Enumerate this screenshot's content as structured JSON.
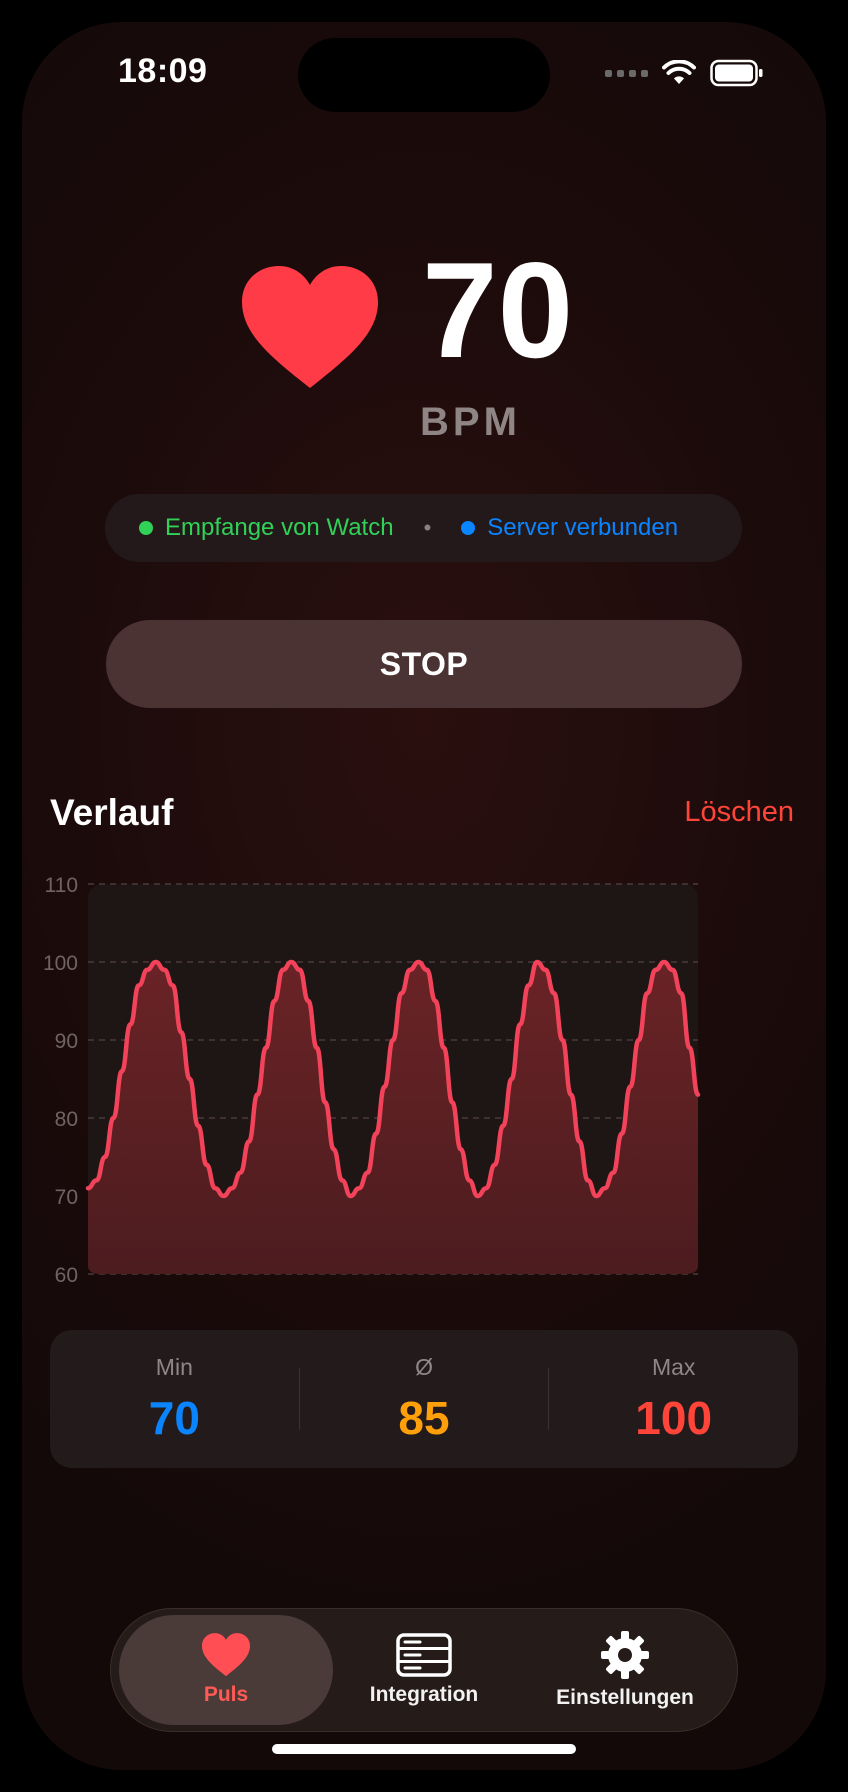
{
  "status_bar": {
    "time": "18:09"
  },
  "heart_rate": {
    "value": "70",
    "unit": "BPM"
  },
  "connection": {
    "watch": "Empfange von Watch",
    "separator": "•",
    "server": "Server verbunden"
  },
  "actions": {
    "stop_label": "STOP"
  },
  "history": {
    "title": "Verlauf",
    "clear_label": "Löschen"
  },
  "chart_data": {
    "type": "area",
    "y_ticks": [
      "110",
      "100",
      "90",
      "80",
      "70",
      "60"
    ],
    "ylim": [
      60,
      110
    ],
    "grid": true,
    "series": [
      {
        "values": [
          71,
          72,
          75,
          80,
          86,
          92,
          97,
          99,
          100,
          99,
          97,
          91,
          85,
          79,
          74,
          71,
          70,
          71,
          73,
          77,
          83,
          89,
          95,
          99,
          100,
          99,
          95,
          89,
          82,
          76,
          72,
          70,
          71,
          73,
          78,
          84,
          90,
          96,
          99,
          100,
          99,
          95,
          89,
          82,
          76,
          72,
          70,
          71,
          74,
          79,
          85,
          92,
          97,
          100,
          99,
          96,
          90,
          83,
          77,
          72,
          70,
          71,
          73,
          78,
          84,
          90,
          96,
          99,
          100,
          99,
          96,
          89,
          83
        ]
      }
    ],
    "colors": {
      "line": "#f2435a",
      "fill_top": "#6a2326",
      "fill_bottom": "#4c1c1f"
    }
  },
  "stats": {
    "min": {
      "label": "Min",
      "value": "70",
      "color": "#0a84ff"
    },
    "avg": {
      "label": "Ø",
      "value": "85",
      "color": "#ff9f0a"
    },
    "max": {
      "label": "Max",
      "value": "100",
      "color": "#ff453a"
    }
  },
  "tabs": [
    {
      "label": "Puls",
      "icon": "heart-icon",
      "active": true
    },
    {
      "label": "Integration",
      "icon": "server-icon",
      "active": false
    },
    {
      "label": "Einstellungen",
      "icon": "gear-icon",
      "active": false
    }
  ]
}
